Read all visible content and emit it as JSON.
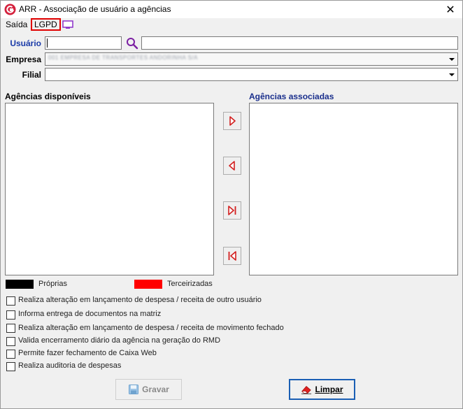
{
  "window": {
    "title": "ARR -  Associação de usuário a agências",
    "close_glyph": "✕"
  },
  "menu": {
    "saida": "Saída",
    "lgpd": "LGPD",
    "monitor_icon": "monitor-icon"
  },
  "form": {
    "usuario_label": "Usuário",
    "usuario_value": "",
    "usuario_name_value": "",
    "empresa_label": "Empresa",
    "empresa_value": "001 EMPRESA DE TRANSPORTES ANDORINHA S/A",
    "filial_label": "Filial",
    "filial_value": ""
  },
  "lists": {
    "available_title": "Agências disponíveis",
    "associated_title": "Agências associadas",
    "available_items": [],
    "associated_items": []
  },
  "legend": {
    "own_label": "Próprias",
    "own_color": "#000000",
    "third_label": "Terceirizadas",
    "third_color": "#ff0000"
  },
  "options": [
    {
      "label": "Realiza alteração em lançamento de despesa / receita de outro usuário",
      "checked": false
    },
    {
      "label": "Informa entrega de documentos na matriz",
      "checked": false
    },
    {
      "label": "Realiza alteração em lançamento de despesa / receita de movimento fechado",
      "checked": false
    },
    {
      "label": "Valida encerramento diário da agência na geração do RMD",
      "checked": false
    },
    {
      "label": "Permite fazer fechamento de Caixa Web",
      "checked": false
    },
    {
      "label": "Realiza auditoria de despesas",
      "checked": false
    }
  ],
  "buttons": {
    "gravar": "Gravar",
    "limpar": "Limpar"
  }
}
